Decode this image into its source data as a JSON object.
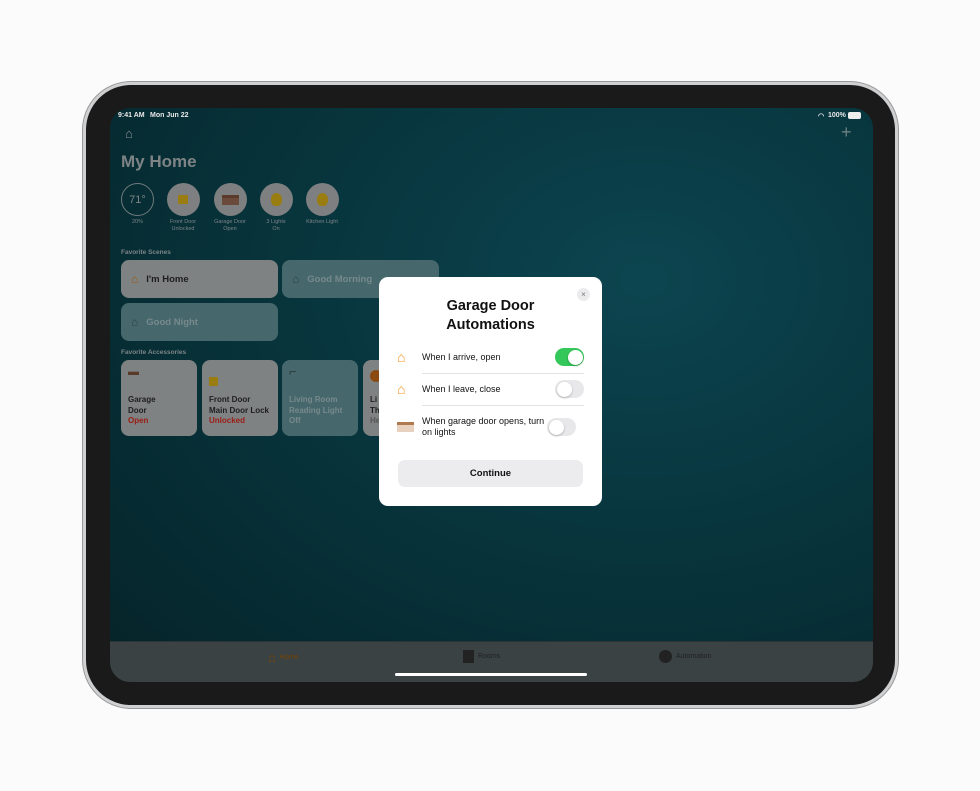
{
  "status": {
    "time": "9:41 AM",
    "date": "Mon Jun 22",
    "battery": "100%"
  },
  "header": {
    "title": "My Home"
  },
  "summary": [
    {
      "value": "71°",
      "sub": "20%"
    },
    {
      "label1": "Front Door",
      "label2": "Unlocked",
      "icon": "lock-open-icon"
    },
    {
      "label1": "Garage Door",
      "label2": "Open",
      "icon": "garage-icon"
    },
    {
      "label1": "3 Lights",
      "label2": "On",
      "icon": "bulb-icon"
    },
    {
      "label1": "Kitchen Light",
      "label2": "",
      "icon": "bulb-icon"
    }
  ],
  "scenes": {
    "heading": "Favorite Scenes",
    "items": [
      {
        "label": "I'm Home"
      },
      {
        "label": "Good Morning"
      },
      {
        "label": "Good Night"
      }
    ]
  },
  "accessories": {
    "heading": "Favorite Accessories",
    "items": [
      {
        "l1": "Garage",
        "l2": "Door",
        "status": "Open"
      },
      {
        "l1": "Front Door",
        "l2": "Main Door Lock",
        "status": "Unlocked"
      },
      {
        "l1": "Living Room",
        "l2": "Reading Light",
        "status": "Off"
      },
      {
        "l1": "Li",
        "l2": "Th",
        "status": "He"
      }
    ]
  },
  "tabs": [
    {
      "label": "Home"
    },
    {
      "label": "Rooms"
    },
    {
      "label": "Automation"
    }
  ],
  "modal": {
    "title_line1": "Garage Door",
    "title_line2": "Automations",
    "close": "×",
    "rows": [
      {
        "label": "When I arrive, open",
        "on": true
      },
      {
        "label": "When I leave, close",
        "on": false
      },
      {
        "label": "When garage door opens, turn on lights",
        "on": false
      }
    ],
    "continue": "Continue"
  },
  "colors": {
    "accent": "#34c759",
    "home_orange": "#f7931e"
  }
}
